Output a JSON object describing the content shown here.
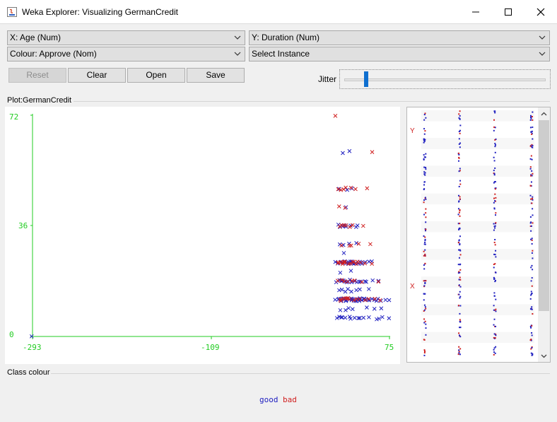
{
  "window": {
    "title": "Weka Explorer: Visualizing GermanCredit",
    "minimize_icon": "minimize-icon",
    "maximize_icon": "maximize-icon",
    "close_icon": "close-icon"
  },
  "controls": {
    "x_axis": "X: Age (Num)",
    "y_axis": "Y: Duration (Num)",
    "colour": "Colour: Approve (Nom)",
    "select_instance": "Select Instance"
  },
  "buttons": {
    "reset": "Reset",
    "clear": "Clear",
    "open": "Open",
    "save": "Save"
  },
  "jitter": {
    "label": "Jitter",
    "value_fraction": 0.11
  },
  "plot": {
    "label": "Plot:GermanCredit",
    "x_ticks": [
      "-293",
      "-109",
      "75"
    ],
    "y_ticks": [
      "72",
      "36",
      "0"
    ]
  },
  "matrix": {
    "y_label": "Y",
    "x_label": "X"
  },
  "class_colour": {
    "label": "Class colour",
    "classes": [
      {
        "name": "good",
        "color": "#2020c0"
      },
      {
        "name": "bad",
        "color": "#d02020"
      }
    ]
  },
  "colors": {
    "accent": "#0f6fcf",
    "axis": "#22cc22",
    "good": "#2020c0",
    "bad": "#d02020"
  },
  "chart_data": {
    "type": "scatter",
    "title": "Plot:GermanCredit",
    "xlabel": "Age (Num)",
    "ylabel": "Duration (Num)",
    "xlim": [
      -293,
      75
    ],
    "ylim": [
      0,
      72
    ],
    "series": [
      {
        "name": "good",
        "points": [
          [
            19,
            12
          ],
          [
            20,
            24
          ],
          [
            21,
            6
          ],
          [
            21,
            18
          ],
          [
            22,
            12
          ],
          [
            22,
            24
          ],
          [
            22,
            36
          ],
          [
            23,
            12
          ],
          [
            23,
            18
          ],
          [
            23,
            48
          ],
          [
            24,
            6
          ],
          [
            24,
            12
          ],
          [
            24,
            15
          ],
          [
            24,
            24
          ],
          [
            24,
            30
          ],
          [
            25,
            6
          ],
          [
            25,
            9
          ],
          [
            25,
            12
          ],
          [
            25,
            18
          ],
          [
            25,
            21
          ],
          [
            25,
            24
          ],
          [
            25,
            36
          ],
          [
            26,
            12
          ],
          [
            26,
            15
          ],
          [
            26,
            24
          ],
          [
            26,
            36
          ],
          [
            27,
            6
          ],
          [
            27,
            12
          ],
          [
            27,
            18
          ],
          [
            27,
            24
          ],
          [
            27,
            27
          ],
          [
            27,
            36
          ],
          [
            27,
            60
          ],
          [
            28,
            12
          ],
          [
            28,
            18
          ],
          [
            28,
            24
          ],
          [
            28,
            30
          ],
          [
            29,
            9
          ],
          [
            29,
            12
          ],
          [
            29,
            18
          ],
          [
            29,
            24
          ],
          [
            29,
            36
          ],
          [
            30,
            6
          ],
          [
            30,
            12
          ],
          [
            30,
            15
          ],
          [
            30,
            24
          ],
          [
            30,
            42
          ],
          [
            31,
            12
          ],
          [
            31,
            18
          ],
          [
            31,
            24
          ],
          [
            31,
            36
          ],
          [
            32,
            9
          ],
          [
            32,
            12
          ],
          [
            32,
            18
          ],
          [
            32,
            24
          ],
          [
            32,
            48
          ],
          [
            33,
            12
          ],
          [
            33,
            15
          ],
          [
            33,
            24
          ],
          [
            33,
            60
          ],
          [
            34,
            6
          ],
          [
            34,
            12
          ],
          [
            34,
            24
          ],
          [
            34,
            30
          ],
          [
            35,
            12
          ],
          [
            35,
            18
          ],
          [
            35,
            21
          ],
          [
            35,
            24
          ],
          [
            35,
            36
          ],
          [
            36,
            6
          ],
          [
            36,
            12
          ],
          [
            36,
            15
          ],
          [
            36,
            24
          ],
          [
            37,
            12
          ],
          [
            37,
            18
          ],
          [
            37,
            24
          ],
          [
            37,
            48
          ],
          [
            38,
            9
          ],
          [
            38,
            12
          ],
          [
            38,
            24
          ],
          [
            39,
            6
          ],
          [
            39,
            12
          ],
          [
            39,
            18
          ],
          [
            39,
            24
          ],
          [
            40,
            12
          ],
          [
            40,
            15
          ],
          [
            40,
            24
          ],
          [
            40,
            36
          ],
          [
            41,
            12
          ],
          [
            41,
            18
          ],
          [
            41,
            30
          ],
          [
            42,
            6
          ],
          [
            42,
            12
          ],
          [
            42,
            24
          ],
          [
            43,
            12
          ],
          [
            43,
            18
          ],
          [
            43,
            36
          ],
          [
            44,
            12
          ],
          [
            44,
            15
          ],
          [
            44,
            24
          ],
          [
            45,
            6
          ],
          [
            45,
            12
          ],
          [
            45,
            24
          ],
          [
            46,
            12
          ],
          [
            46,
            18
          ],
          [
            47,
            12
          ],
          [
            47,
            24
          ],
          [
            48,
            6
          ],
          [
            48,
            12
          ],
          [
            49,
            12
          ],
          [
            49,
            18
          ],
          [
            50,
            12
          ],
          [
            50,
            24
          ],
          [
            51,
            12
          ],
          [
            52,
            9
          ],
          [
            52,
            18
          ],
          [
            53,
            12
          ],
          [
            53,
            24
          ],
          [
            54,
            6
          ],
          [
            54,
            15
          ],
          [
            55,
            12
          ],
          [
            56,
            24
          ],
          [
            57,
            12
          ],
          [
            58,
            18
          ],
          [
            59,
            9
          ],
          [
            60,
            12
          ],
          [
            61,
            6
          ],
          [
            62,
            12
          ],
          [
            63,
            18
          ],
          [
            64,
            12
          ],
          [
            65,
            6
          ],
          [
            66,
            12
          ],
          [
            67,
            9
          ],
          [
            68,
            6
          ],
          [
            70,
            12
          ],
          [
            74,
            12
          ],
          [
            75,
            6
          ]
        ]
      },
      {
        "name": "bad",
        "points": [
          [
            20,
            72
          ],
          [
            21,
            24
          ],
          [
            22,
            18
          ],
          [
            22,
            48
          ],
          [
            23,
            24
          ],
          [
            23,
            36
          ],
          [
            24,
            12
          ],
          [
            24,
            24
          ],
          [
            24,
            42
          ],
          [
            25,
            12
          ],
          [
            25,
            30
          ],
          [
            25,
            48
          ],
          [
            26,
            18
          ],
          [
            26,
            24
          ],
          [
            26,
            36
          ],
          [
            27,
            12
          ],
          [
            27,
            24
          ],
          [
            27,
            48
          ],
          [
            28,
            12
          ],
          [
            28,
            24
          ],
          [
            28,
            36
          ],
          [
            29,
            18
          ],
          [
            29,
            24
          ],
          [
            29,
            42
          ],
          [
            30,
            12
          ],
          [
            30,
            24
          ],
          [
            30,
            48
          ],
          [
            31,
            12
          ],
          [
            31,
            36
          ],
          [
            32,
            18
          ],
          [
            32,
            24
          ],
          [
            33,
            12
          ],
          [
            33,
            30
          ],
          [
            34,
            24
          ],
          [
            34,
            36
          ],
          [
            35,
            12
          ],
          [
            35,
            48
          ],
          [
            36,
            18
          ],
          [
            36,
            30
          ],
          [
            37,
            24
          ],
          [
            38,
            12
          ],
          [
            38,
            36
          ],
          [
            39,
            24
          ],
          [
            40,
            18
          ],
          [
            40,
            48
          ],
          [
            41,
            24
          ],
          [
            42,
            12
          ],
          [
            43,
            24
          ],
          [
            44,
            30
          ],
          [
            45,
            12
          ],
          [
            46,
            24
          ],
          [
            47,
            18
          ],
          [
            48,
            36
          ],
          [
            49,
            12
          ],
          [
            50,
            24
          ],
          [
            52,
            48
          ],
          [
            53,
            12
          ],
          [
            55,
            30
          ],
          [
            57,
            24
          ],
          [
            58,
            60
          ],
          [
            60,
            12
          ],
          [
            63,
            18
          ],
          [
            66,
            12
          ]
        ]
      },
      {
        "name": "good",
        "points": [
          [
            -293,
            0
          ]
        ]
      }
    ]
  }
}
